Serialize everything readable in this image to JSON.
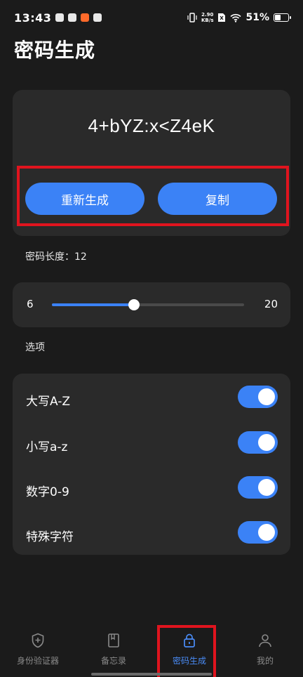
{
  "status_bar": {
    "time": "13:43",
    "net_speed_value": "2.90",
    "net_speed_unit": "KB/s",
    "battery": "51%",
    "battery_level": 0.51
  },
  "page": {
    "title": "密码生成"
  },
  "password": {
    "value": "4+bYZ:x<Z4eK"
  },
  "buttons": {
    "regenerate": "重新生成",
    "copy": "复制"
  },
  "length": {
    "label": "密码长度：12",
    "min": "6",
    "max": "20",
    "value": 12,
    "range": [
      6,
      20
    ]
  },
  "options": {
    "section_label": "选项",
    "items": [
      {
        "label": "大写A-Z",
        "enabled": true
      },
      {
        "label": "小写a-z",
        "enabled": true
      },
      {
        "label": "数字0-9",
        "enabled": true
      },
      {
        "label": "特殊字符",
        "enabled": true
      }
    ]
  },
  "nav": {
    "items": [
      {
        "label": "身份验证器",
        "icon": "shield-plus-icon"
      },
      {
        "label": "备忘录",
        "icon": "book-icon"
      },
      {
        "label": "密码生成",
        "icon": "lock-icon"
      },
      {
        "label": "我的",
        "icon": "person-icon"
      }
    ],
    "active_index": 2,
    "active_color": "#4a8cf7",
    "inactive_color": "#8a8a8a"
  },
  "colors": {
    "accent": "#3b82f6",
    "highlight": "#e0141e",
    "background": "#1b1b1b",
    "card": "#2a2a2a"
  }
}
